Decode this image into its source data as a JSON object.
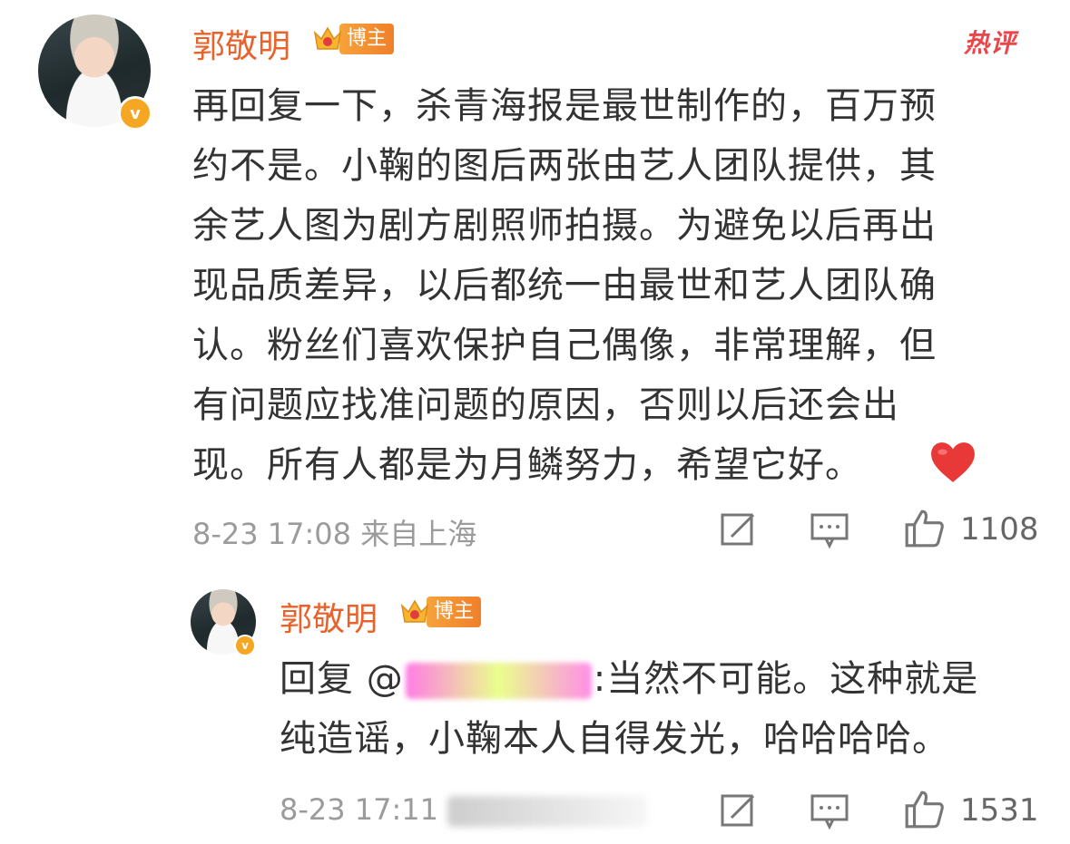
{
  "comment": {
    "username": "郭敬明",
    "badge": "博主",
    "hot_label": "热评",
    "lines": [
      "再回复一下，杀青海报是最世制作的，百万预",
      "约不是。小鞠的图后两张由艺人团队提供，其",
      "余艺人图为剧方剧照师拍摄。为避免以后再出",
      "现品质差异，以后都统一由最世和艺人团队确",
      "认。粉丝们喜欢保护自己偶像，非常理解，但",
      "有问题应找准问题的原因，否则以后还会出",
      "现。所有人都是为月鳞努力，希望它好。"
    ],
    "emoji": "heart",
    "meta": "8-23 17:08 来自上海",
    "likes": "1108"
  },
  "reply": {
    "username": "郭敬明",
    "badge": "博主",
    "prefix": "回复 @",
    "line1_rest": ":当然不可能。这种就是",
    "line2": "纯造谣，小鞠本人自得发光，哈哈哈哈。",
    "meta_time": "8-23 17:11",
    "likes": "1531"
  },
  "colors": {
    "username": "#e8632c",
    "hot": "#e8464a",
    "text": "#333333",
    "meta": "#9b9b9b",
    "verified": "#f5a623"
  }
}
